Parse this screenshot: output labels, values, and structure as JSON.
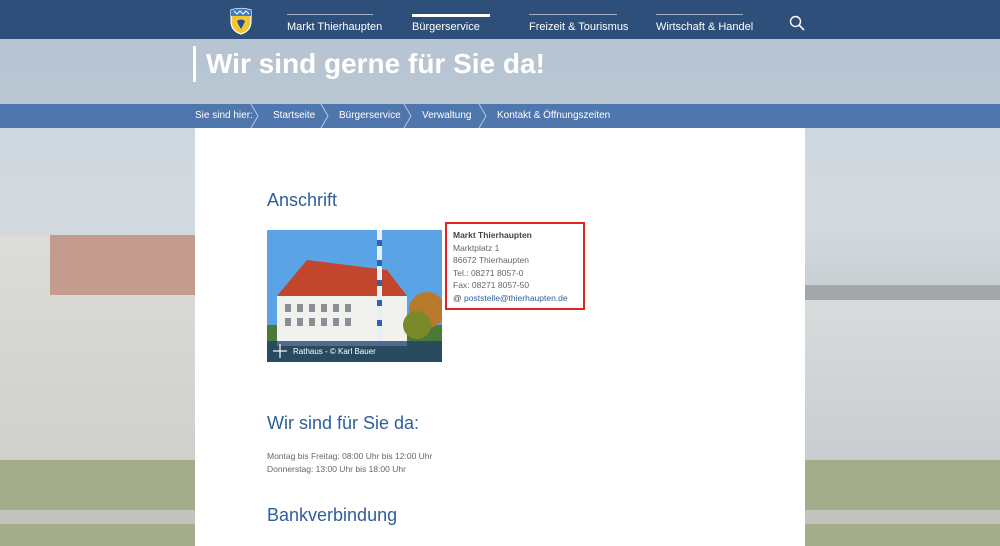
{
  "nav": {
    "items": [
      {
        "label": "Markt Thierhaupten",
        "active": false
      },
      {
        "label": "Bürgerservice",
        "active": true
      },
      {
        "label": "Freizeit & Tourismus",
        "active": false
      },
      {
        "label": "Wirtschaft & Handel",
        "active": false
      }
    ],
    "icons": {
      "crest": "coat-of-arms-icon",
      "search": "search-icon"
    }
  },
  "hero": {
    "title": "Wir sind gerne für Sie da!"
  },
  "breadcrumb": {
    "prefix": "Sie sind hier:",
    "items": [
      "Startseite",
      "Bürgerservice",
      "Verwaltung",
      "Kontakt & Öffnungszeiten"
    ]
  },
  "content": {
    "anschrift_heading": "Anschrift",
    "photo_caption": "Rathaus - © Karl Bauer",
    "address": {
      "name": "Markt Thierhaupten",
      "street": "Marktplatz 1",
      "city": "86672 Thierhaupten",
      "tel": "Tel.: 08271 8057-0",
      "fax": "Fax: 08271 8057-50",
      "email_symbol": "@",
      "email": "poststelle@thierhaupten.de"
    },
    "hours_heading": "Wir sind für Sie da:",
    "hours": [
      "Montag bis Freitag: 08:00 Uhr bis 12:00 Uhr",
      "Donnerstag: 13:00 Uhr bis 18:00 Uhr"
    ],
    "bank_heading": "Bankverbindung"
  },
  "colors": {
    "nav_bg": "#2d4f7a",
    "breadcrumb_bg": "#4f76ad",
    "heading": "#2d5f99",
    "highlight_border": "#e02222"
  }
}
